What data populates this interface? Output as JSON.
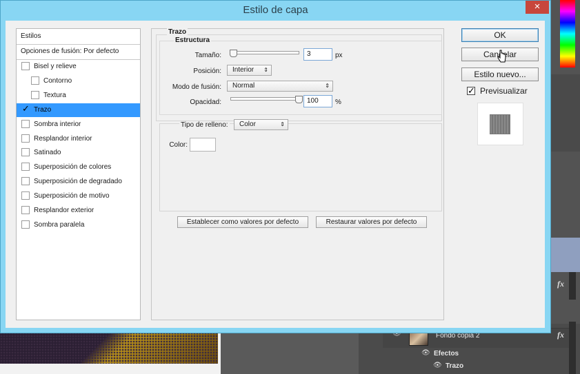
{
  "dialog": {
    "title": "Estilo de capa",
    "close_icon": "×"
  },
  "styles_list": {
    "header": "Estilos",
    "blending": "Opciones de fusión: Por defecto",
    "items": [
      {
        "label": "Bisel y relieve",
        "checked": false,
        "indent": false
      },
      {
        "label": "Contorno",
        "checked": false,
        "indent": true
      },
      {
        "label": "Textura",
        "checked": false,
        "indent": true
      },
      {
        "label": "Trazo",
        "checked": true,
        "indent": false,
        "selected": true
      },
      {
        "label": "Sombra interior",
        "checked": false,
        "indent": false
      },
      {
        "label": "Resplandor interior",
        "checked": false,
        "indent": false
      },
      {
        "label": "Satinado",
        "checked": false,
        "indent": false
      },
      {
        "label": "Superposición de colores",
        "checked": false,
        "indent": false
      },
      {
        "label": "Superposición de degradado",
        "checked": false,
        "indent": false
      },
      {
        "label": "Superposición de motivo",
        "checked": false,
        "indent": false
      },
      {
        "label": "Resplandor exterior",
        "checked": false,
        "indent": false
      },
      {
        "label": "Sombra paralela",
        "checked": false,
        "indent": false
      }
    ]
  },
  "stroke": {
    "group_title": "Trazo",
    "structure_title": "Estructura",
    "size_label": "Tamaño:",
    "size_value": "3",
    "size_unit": "px",
    "position_label": "Posición:",
    "position_value": "Interior",
    "blend_label": "Modo de fusión:",
    "blend_value": "Normal",
    "opacity_label": "Opacidad:",
    "opacity_value": "100",
    "opacity_unit": "%",
    "fill_type_label": "Tipo de relleno:",
    "fill_type_value": "Color",
    "color_label": "Color:",
    "color_value": "#ffffff",
    "size_slider_fraction": 0.03,
    "opacity_slider_fraction": 1.0
  },
  "defaults": {
    "set_default": "Establecer como valores por defecto",
    "reset_default": "Restaurar valores por defecto"
  },
  "buttons": {
    "ok": "OK",
    "cancel": "Cancelar",
    "new_style": "Estilo nuevo...",
    "preview_label": "Previsualizar",
    "preview_checked": true
  },
  "layers_panel": {
    "layer_name": "Fondo copia 2",
    "effects_label": "Efectos",
    "stroke_label": "Trazo",
    "fx_label": "fx"
  },
  "colors": {
    "title_bar": "#88d6f3",
    "selection": "#3399ff",
    "close_button": "#c7463c"
  }
}
